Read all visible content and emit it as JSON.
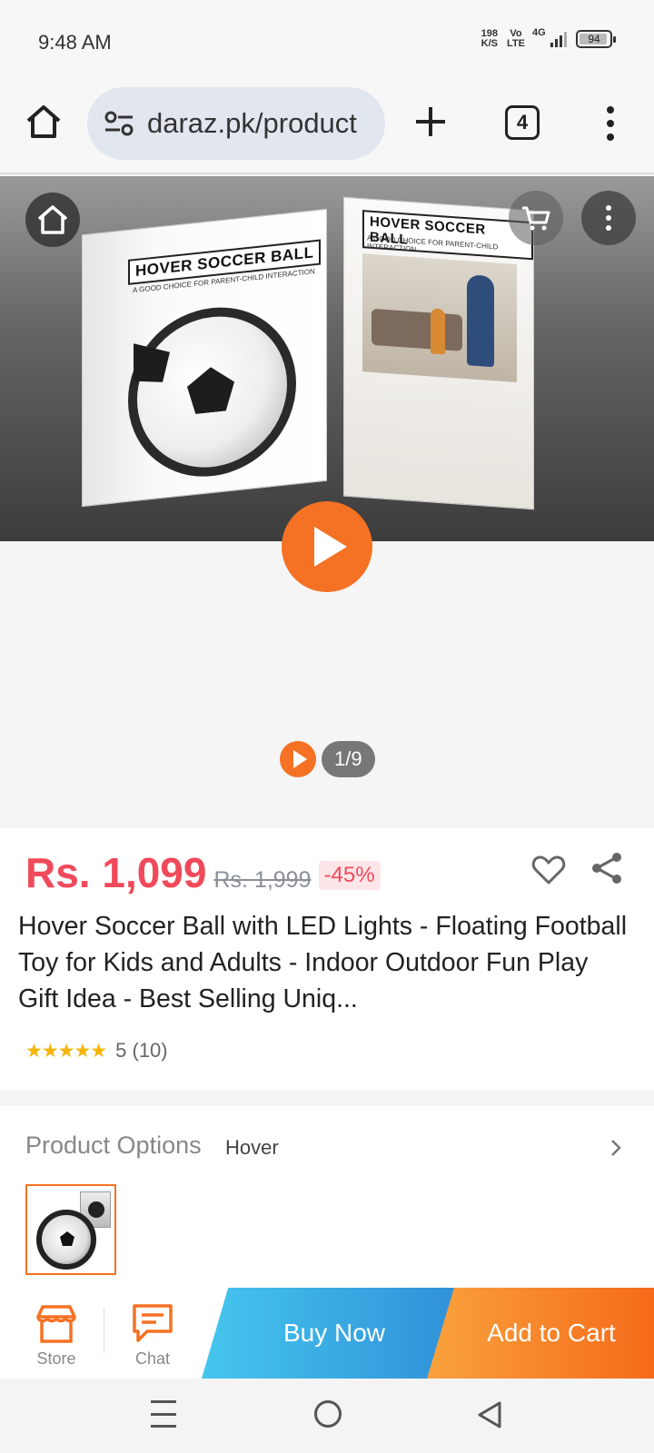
{
  "status_bar": {
    "time": "9:48 AM",
    "net_speed_value": "198",
    "net_speed_unit": "K/S",
    "volte_top": "Vo",
    "volte_bottom": "LTE",
    "network": "4G",
    "battery": "94"
  },
  "browser": {
    "url": "daraz.pk/product",
    "tab_count": "4"
  },
  "gallery": {
    "box_title": "HOVER SOCCER BALL",
    "box_subtitle": "A GOOD CHOICE FOR PARENT-CHILD INTERACTION",
    "counter": "1/9"
  },
  "product": {
    "price": "Rs. 1,099",
    "old_price": "Rs. 1,999",
    "discount": "-45%",
    "title": "Hover Soccer Ball with LED Lights - Floating Football Toy for Kids and Adults - Indoor Outdoor Fun Play Gift Idea - Best Selling Uniq...",
    "stars": "★★★★★",
    "rating": "5 (10)"
  },
  "options": {
    "label": "Product Options",
    "value": "Hover"
  },
  "actions": {
    "store": "Store",
    "chat": "Chat",
    "buy_now": "Buy Now",
    "add_to_cart": "Add to Cart"
  },
  "colors": {
    "accent_orange": "#f57224",
    "price_red": "#f04a5a",
    "buy_now_blue": "#2f8fd8"
  }
}
